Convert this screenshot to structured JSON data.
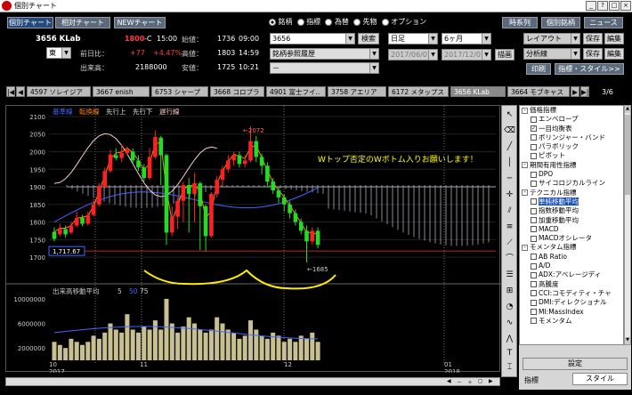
{
  "window": {
    "title": "個別チャート",
    "controls": [
      "_",
      "?",
      "□",
      "×"
    ]
  },
  "top": {
    "buttons": [
      "個別チャート",
      "相対チャート",
      "NEWチャート"
    ],
    "stock": {
      "code_name": "3656 KLab",
      "price": "1800",
      "price_flag": "-C",
      "time": "15:00",
      "open_label": "始値：",
      "open": "1736",
      "open_time": "09:00",
      "market": "東",
      "prev_label": "前日比：",
      "change": "+77",
      "pct": "+4.47%",
      "high_label": "高値：",
      "high": "1803",
      "high_time": "14:59",
      "vol_label": "出来高：",
      "volume": "2188000",
      "low_label": "安値：",
      "low": "1725",
      "low_time": "10:21"
    },
    "radios": [
      {
        "label": "銘柄",
        "on": true
      },
      {
        "label": "指標",
        "on": false
      },
      {
        "label": "為替",
        "on": false
      },
      {
        "label": "先物",
        "on": false
      },
      {
        "label": "オプション",
        "on": false
      }
    ],
    "code_input": "3656",
    "search": "検索",
    "hist_select": "銘柄参照履歴",
    "blank_select": "－",
    "period": "日足",
    "range": "6ヶ月",
    "date_from": "2017/06/07",
    "date_to": "2017/12/07",
    "draw": "描画",
    "right_buttons": [
      "時系列",
      "個別銘柄",
      "ニュース"
    ],
    "layout": "レイアウト",
    "save": "保存",
    "edit": "編集",
    "analysis": "分析線",
    "print": "印刷",
    "ind_style": "指標・スタイル>>"
  },
  "tabs": {
    "items": [
      "4597 ソレイジア",
      "3667 enish",
      "6753 シャープ",
      "3668 コロプラ",
      "4901 富士フイ..",
      "3758 アエリア",
      "6172 メタップス",
      "3656 KLab",
      "3664 モブキャス"
    ],
    "selected": 7,
    "page": "3/6"
  },
  "chart": {
    "legend": [
      {
        "label": "基準線",
        "color": "#4466ff"
      },
      {
        "label": "転換線",
        "color": "#ff8800"
      },
      {
        "label": "先行上",
        "color": "#dddddd"
      },
      {
        "label": "先行下",
        "color": "#dddddd"
      },
      {
        "label": "遅行線",
        "color": "#ffcccc"
      }
    ],
    "y_ticks": [
      "2100",
      "2050",
      "2000",
      "1950",
      "1900",
      "1850",
      "1800",
      "1750",
      "1700"
    ],
    "annotation": "Wトップ否定のWボトム入りお願いします！",
    "high_mark": "←2072",
    "low_mark": "←1685",
    "price_box": "1,717.67",
    "vol_legend": "出来高移動平均",
    "vol_periods": [
      "5",
      "50",
      "75"
    ],
    "vol_ticks": [
      "10000000",
      "6000000",
      "2000000"
    ],
    "x_labels": [
      "10",
      "11",
      "12",
      "01"
    ],
    "years": [
      "2017",
      "2018"
    ]
  },
  "chart_data": {
    "type": "candlestick",
    "price_ylim": [
      1680,
      2110
    ],
    "candles": [
      [
        1772,
        1752,
        1785,
        1745
      ],
      [
        1765,
        1780,
        1795,
        1760
      ],
      [
        1780,
        1765,
        1790,
        1755
      ],
      [
        1770,
        1790,
        1800,
        1765
      ],
      [
        1790,
        1812,
        1830,
        1785
      ],
      [
        1812,
        1795,
        1820,
        1788
      ],
      [
        1795,
        1820,
        1830,
        1790
      ],
      [
        1820,
        1850,
        1865,
        1815
      ],
      [
        1850,
        1902,
        1910,
        1845
      ],
      [
        1900,
        1945,
        1955,
        1895
      ],
      [
        1945,
        1992,
        2005,
        1940
      ],
      [
        1990,
        1982,
        2010,
        1975
      ],
      [
        1982,
        1996,
        2020,
        1970
      ],
      [
        1996,
        2005,
        2015,
        1990
      ],
      [
        2000,
        1975,
        2010,
        1965
      ],
      [
        1975,
        1955,
        1990,
        1945
      ],
      [
        1955,
        1925,
        1965,
        1915
      ],
      [
        1925,
        1985,
        2010,
        1920
      ],
      [
        1985,
        2042,
        2060,
        1980
      ],
      [
        2040,
        1990,
        2045,
        1905
      ],
      [
        1990,
        1770,
        1995,
        1735
      ],
      [
        1770,
        1815,
        1845,
        1760
      ],
      [
        1815,
        1860,
        1870,
        1780
      ],
      [
        1860,
        1905,
        1915,
        1800
      ],
      [
        1905,
        1880,
        1925,
        1770
      ],
      [
        1880,
        1910,
        1940,
        1800
      ],
      [
        1910,
        1845,
        1915,
        1720
      ],
      [
        1845,
        1760,
        1850,
        1715
      ],
      [
        1760,
        1880,
        1885,
        1755
      ],
      [
        1880,
        1920,
        1930,
        1870
      ],
      [
        1920,
        1950,
        1960,
        1900
      ],
      [
        1950,
        1975,
        1990,
        1940
      ],
      [
        1975,
        1990,
        2000,
        1960
      ],
      [
        1990,
        1965,
        2000,
        1955
      ],
      [
        1965,
        1975,
        1990,
        1955
      ],
      [
        1975,
        2030,
        2072,
        1970
      ],
      [
        2030,
        1985,
        2045,
        1970
      ],
      [
        1985,
        1960,
        1995,
        1935
      ],
      [
        1960,
        1915,
        1970,
        1900
      ],
      [
        1915,
        1890,
        1925,
        1880
      ],
      [
        1890,
        1870,
        1900,
        1855
      ],
      [
        1870,
        1850,
        1880,
        1830
      ],
      [
        1850,
        1825,
        1860,
        1810
      ],
      [
        1825,
        1800,
        1835,
        1790
      ],
      [
        1800,
        1775,
        1810,
        1765
      ],
      [
        1775,
        1745,
        1790,
        1685
      ],
      [
        1745,
        1775,
        1785,
        1735
      ],
      [
        1775,
        1735,
        1785,
        1725
      ]
    ],
    "volumes": [
      3.0,
      2.5,
      2.0,
      3.5,
      3.0,
      2.5,
      3.0,
      4.0,
      3.5,
      4.5,
      6.0,
      5.0,
      4.5,
      7.5,
      5.0,
      4.5,
      5.5,
      5.0,
      6.5,
      5.0,
      10.0,
      6.0,
      4.5,
      5.5,
      7.0,
      6.0,
      5.0,
      4.5,
      5.0,
      7.0,
      6.0,
      5.0,
      4.5,
      3.5,
      4.0,
      6.5,
      5.0,
      4.0,
      3.5,
      4.5,
      4.0,
      3.0,
      3.5,
      3.0,
      4.0,
      3.5,
      4.5,
      3.0
    ],
    "volume_unit": "millions",
    "volume_ylim": [
      0,
      11
    ]
  },
  "panel": {
    "items": [
      {
        "t": "価格指標",
        "lv": 0,
        "ex": "-"
      },
      {
        "t": "エンベロープ",
        "lv": 1,
        "cb": ""
      },
      {
        "t": "一目均衡表",
        "lv": 1,
        "cb": "✓"
      },
      {
        "t": "ボリンジャー・バンド",
        "lv": 1,
        "cb": ""
      },
      {
        "t": "パラボリック",
        "lv": 1,
        "cb": ""
      },
      {
        "t": "ピボット",
        "lv": 1,
        "cb": ""
      },
      {
        "t": "期間有用性指標",
        "lv": 0,
        "ex": "-"
      },
      {
        "t": "DPO",
        "lv": 1,
        "cb": ""
      },
      {
        "t": "サイコロジカルライン",
        "lv": 1,
        "cb": ""
      },
      {
        "t": "テクニカル指標",
        "lv": 0,
        "ex": "-"
      },
      {
        "t": "単純移動平均",
        "lv": 1,
        "cb": "",
        "hl": true
      },
      {
        "t": "指数移動平均",
        "lv": 1,
        "cb": ""
      },
      {
        "t": "加重移動平均",
        "lv": 1,
        "cb": ""
      },
      {
        "t": "MACD",
        "lv": 1,
        "cb": ""
      },
      {
        "t": "MACDオシレータ",
        "lv": 1,
        "cb": ""
      },
      {
        "t": "モメンタム指標",
        "lv": 0,
        "ex": "-"
      },
      {
        "t": "AB Ratio",
        "lv": 1,
        "cb": ""
      },
      {
        "t": "A/D",
        "lv": 1,
        "cb": ""
      },
      {
        "t": "ADX:アベレージディ",
        "lv": 1,
        "cb": ""
      },
      {
        "t": "高騰度",
        "lv": 1,
        "cb": ""
      },
      {
        "t": "CCI:コモディティ・チャ",
        "lv": 1,
        "cb": ""
      },
      {
        "t": "DMI:ディレクショナル",
        "lv": 1,
        "cb": ""
      },
      {
        "t": "MI:MassIndex",
        "lv": 1,
        "cb": ""
      },
      {
        "t": "モメンタム",
        "lv": 1,
        "cb": ""
      }
    ],
    "settings": "設定",
    "indicator": "指標",
    "style": "スタイル"
  }
}
